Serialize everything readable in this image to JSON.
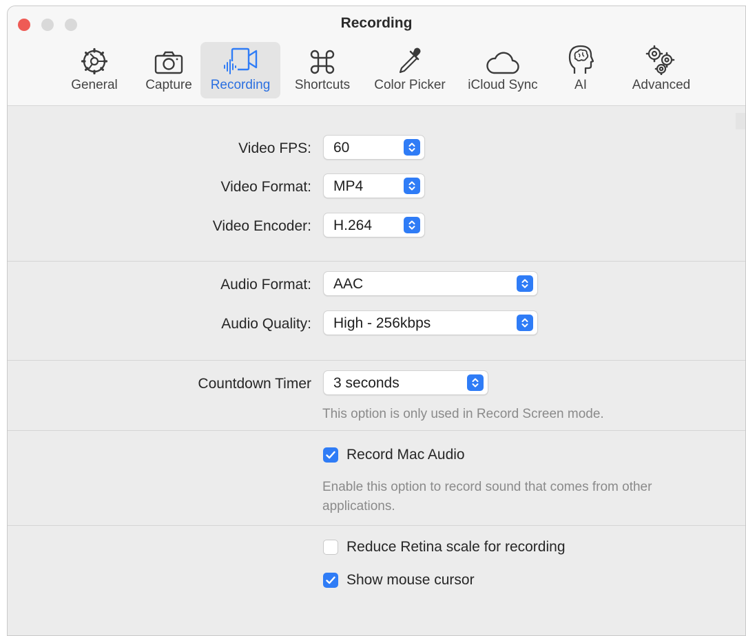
{
  "window": {
    "title": "Recording"
  },
  "tabs": [
    {
      "label": "General",
      "icon": "gear-icon"
    },
    {
      "label": "Capture",
      "icon": "camera-icon"
    },
    {
      "label": "Recording",
      "icon": "video-recording-icon",
      "active": true
    },
    {
      "label": "Shortcuts",
      "icon": "command-key-icon"
    },
    {
      "label": "Color Picker",
      "icon": "eyedropper-icon"
    },
    {
      "label": "iCloud Sync",
      "icon": "cloud-icon"
    },
    {
      "label": "AI",
      "icon": "brain-head-icon"
    },
    {
      "label": "Advanced",
      "icon": "gears-icon"
    }
  ],
  "video": {
    "fps": {
      "label": "Video FPS:",
      "value": "60"
    },
    "format": {
      "label": "Video Format:",
      "value": "MP4"
    },
    "encoder": {
      "label": "Video Encoder:",
      "value": "H.264"
    }
  },
  "audio": {
    "format": {
      "label": "Audio Format:",
      "value": "AAC"
    },
    "quality": {
      "label": "Audio Quality:",
      "value": "High - 256kbps"
    }
  },
  "countdown": {
    "label": "Countdown Timer",
    "value": "3 seconds",
    "hint": "This option is only used in Record Screen mode."
  },
  "mac_audio": {
    "label": "Record Mac Audio",
    "checked": true,
    "hint": "Enable this option to record sound that comes from other applications."
  },
  "retina": {
    "label": "Reduce Retina scale for recording",
    "checked": false
  },
  "cursor": {
    "label": "Show mouse cursor",
    "checked": true
  },
  "colors": {
    "accent": "#2f7cf6",
    "close": "#ee5b55",
    "active_tab_text": "#2a6fe0"
  }
}
